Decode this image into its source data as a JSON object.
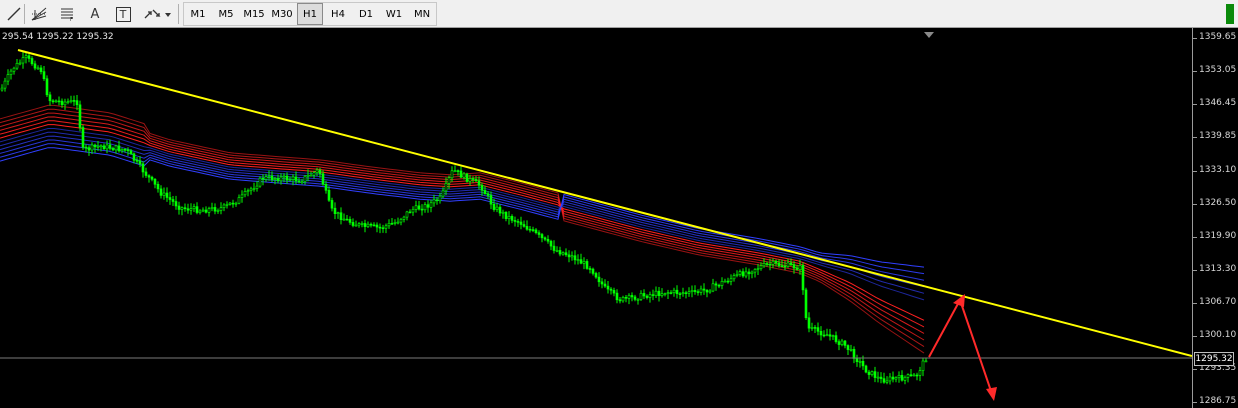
{
  "toolbar": {
    "tools": [
      {
        "name": "line-tool-icon"
      },
      {
        "name": "fibonacci-fan-icon"
      },
      {
        "name": "fibonacci-retracement-icon"
      },
      {
        "name": "text-tool-icon",
        "glyph": "A"
      },
      {
        "name": "text-label-icon",
        "glyph": "T"
      },
      {
        "name": "arrows-icon"
      }
    ],
    "timeframes": [
      "M1",
      "M5",
      "M15",
      "M30",
      "H1",
      "H4",
      "D1",
      "W1",
      "MN"
    ],
    "active_timeframe": "H1"
  },
  "chart": {
    "ohlc_text": "295.54 1295.22 1295.32",
    "current_price": "1295.32",
    "price_labels": [
      "1359.65",
      "1353.05",
      "1346.45",
      "1339.85",
      "1333.10",
      "1326.50",
      "1319.90",
      "1313.30",
      "1306.70",
      "1300.10",
      "1293.35",
      "1286.75"
    ],
    "colors": {
      "candles": "#00ff00",
      "trendline": "#ffff00",
      "arrows": "#ff2a2a",
      "ribbon_red": "#ff2020",
      "ribbon_blue": "#3040ff",
      "background": "#000000"
    }
  }
}
